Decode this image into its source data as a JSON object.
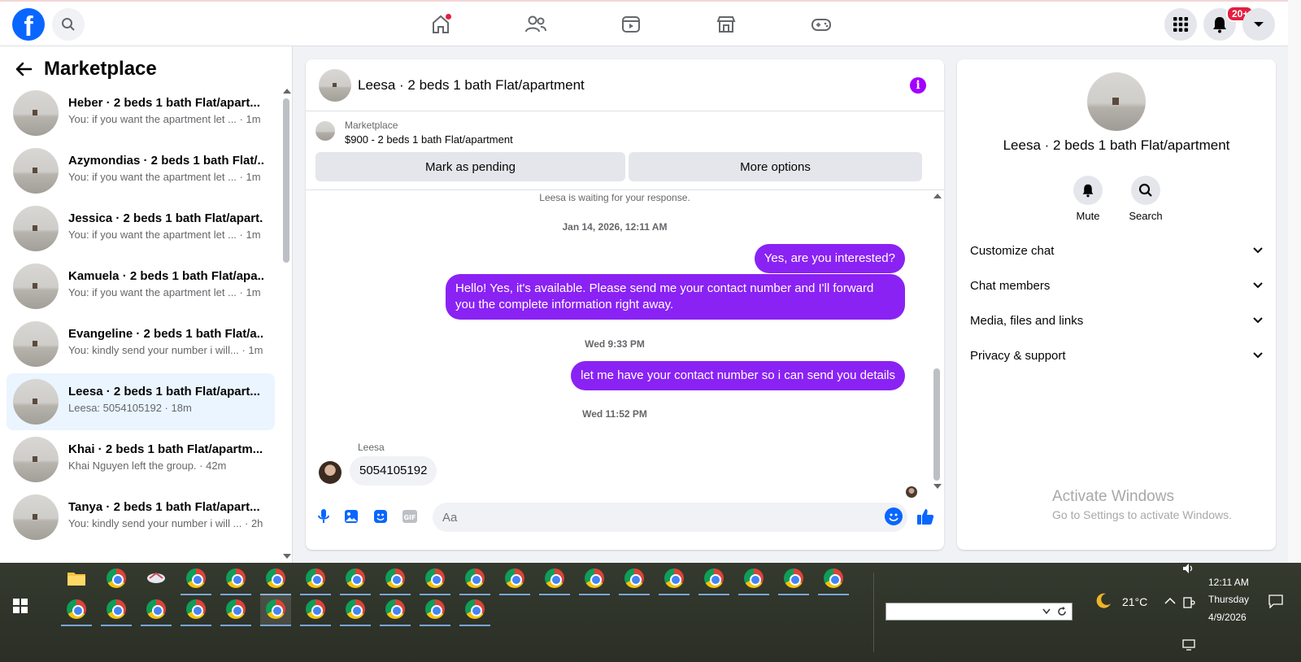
{
  "nav": {
    "logo": "f",
    "notifications_badge": "20+",
    "icons": [
      "search-icon",
      "home-icon",
      "friends-icon",
      "video-icon",
      "marketplace-icon",
      "gaming-icon",
      "menu-grid-icon",
      "bell-icon",
      "chevron-down-icon"
    ]
  },
  "sidebar": {
    "title": "Marketplace",
    "conversations": [
      {
        "name": "Heber · 2 beds 1 bath Flat/apart...",
        "snippet": "You: if you want the apartment let ... · 1m"
      },
      {
        "name": "Azymondias · 2 beds 1 bath Flat/...",
        "snippet": "You: if you want the apartment let ... · 1m"
      },
      {
        "name": "Jessica · 2 beds 1 bath Flat/apart...",
        "snippet": "You: if you want the apartment let ... · 1m"
      },
      {
        "name": "Kamuela · 2 beds 1 bath Flat/apa...",
        "snippet": "You: if you want the apartment let ... · 1m"
      },
      {
        "name": "Evangeline · 2 beds 1 bath Flat/a...",
        "snippet": "You: kindly send your number i will... · 1m"
      },
      {
        "name": "Leesa · 2 beds 1 bath Flat/apart...",
        "snippet": "Leesa: 5054105192 · 18m"
      },
      {
        "name": "Khai · 2 beds 1 bath Flat/apartm...",
        "snippet": "Khai Nguyen left the group. · 42m"
      },
      {
        "name": "Tanya · 2 beds 1 bath Flat/apart...",
        "snippet": "You: kindly send your number i will ... · 2h"
      }
    ]
  },
  "chat": {
    "title": "Leesa · 2 beds 1 bath Flat/apartment",
    "marketplace_label": "Marketplace",
    "listing": "$900 - 2 beds 1 bath Flat/apartment",
    "mark_pending": "Mark as pending",
    "more_options": "More options",
    "waiting": "Leesa is waiting for your response.",
    "ts1": "Jan 14, 2026, 12:11 AM",
    "msg1": "Yes, are you interested?",
    "msg2": "Hello! Yes, it's available. Please send me your contact number and I'll forward you the complete information right away.",
    "ts2": "Wed 9:33 PM",
    "msg3": "let me have your contact number so i can send you details",
    "ts3": "Wed 11:52 PM",
    "sender": "Leesa",
    "msg4": "5054105192",
    "composer_placeholder": "Aa",
    "accent": "#8a22f4"
  },
  "details": {
    "title": "Leesa · 2 beds 1 bath Flat/apartment",
    "mute": "Mute",
    "search": "Search",
    "rows": [
      "Customize chat",
      "Chat members",
      "Media, files and links",
      "Privacy & support"
    ],
    "watermark_title": "Activate Windows",
    "watermark_sub": "Go to Settings to activate Windows."
  },
  "taskbar": {
    "temperature": "21°C",
    "time": "12:11 AM",
    "day": "Thursday",
    "date": "4/9/2026"
  }
}
